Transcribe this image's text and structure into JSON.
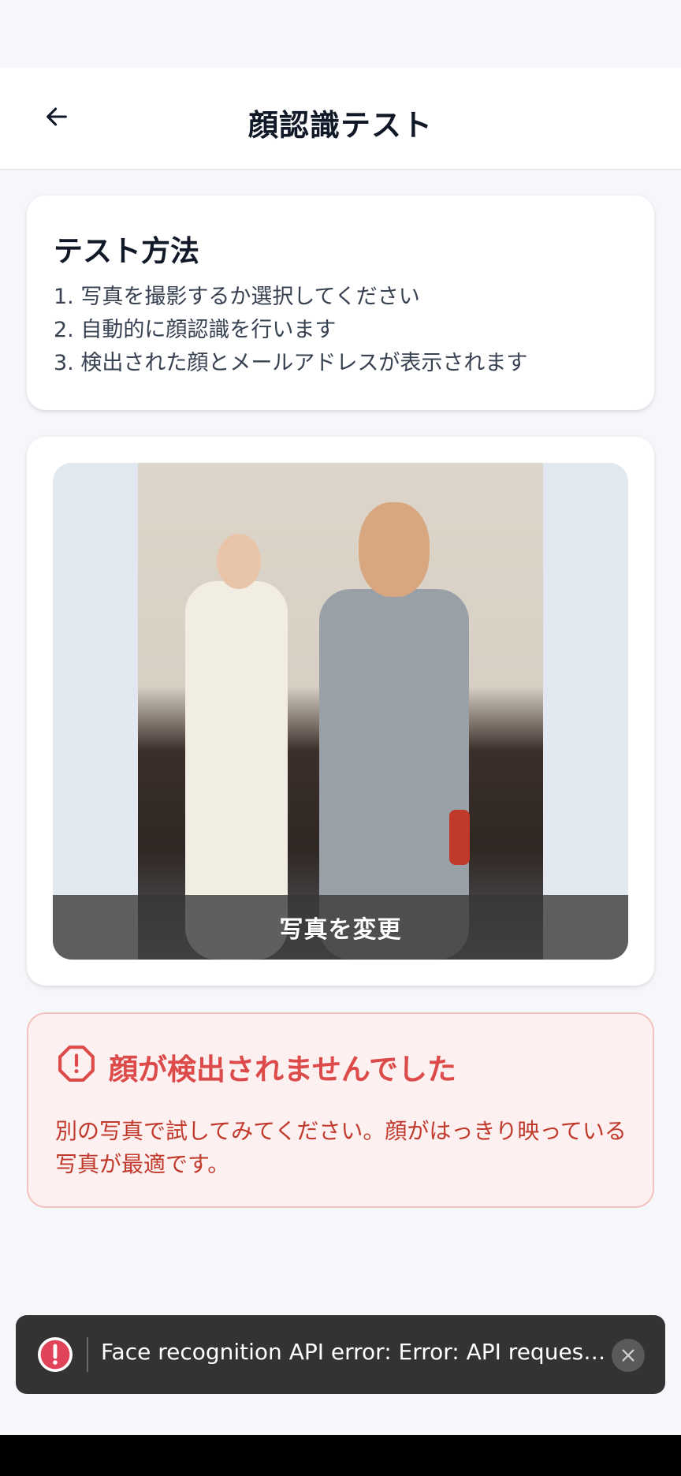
{
  "header": {
    "title": "顔認識テスト"
  },
  "instructions": {
    "title": "テスト方法",
    "steps": [
      "1. 写真を撮影するか選択してください",
      "2. 自動的に顔認識を行います",
      "3. 検出された顔とメールアドレスが表示されます"
    ]
  },
  "photo": {
    "change_label": "写真を変更"
  },
  "error": {
    "title": "顔が検出されませんでした",
    "message": "別の写真で試してみてください。顔がはっきり映っている写真が最適です。",
    "color": "#dc4a4a"
  },
  "toast": {
    "message": "Face recognition API error: Error: API request f..."
  }
}
